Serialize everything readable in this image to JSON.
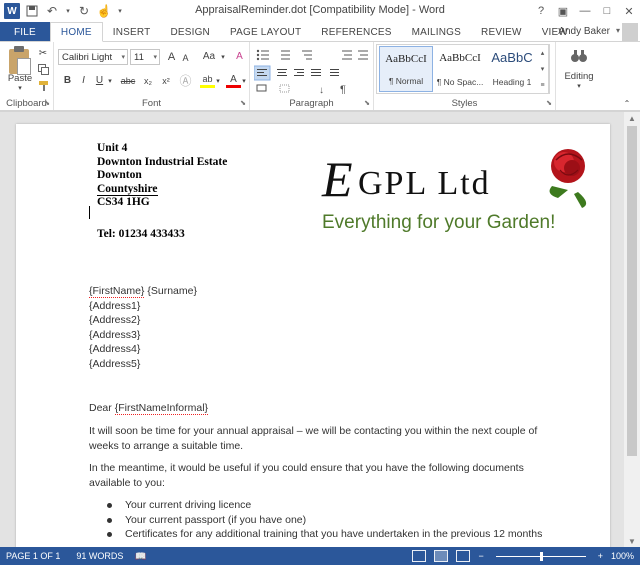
{
  "window": {
    "title": "AppraisalReminder.dot [Compatibility Mode] - Word",
    "app_icon_letter": "W"
  },
  "tabs": {
    "file": "FILE",
    "items": [
      "HOME",
      "INSERT",
      "DESIGN",
      "PAGE LAYOUT",
      "REFERENCES",
      "MAILINGS",
      "REVIEW",
      "VIEW"
    ],
    "active": "HOME"
  },
  "user": {
    "name": "Andy Baker"
  },
  "ribbon": {
    "clipboard": {
      "label": "Clipboard",
      "paste_label": "Paste"
    },
    "font": {
      "label": "Font",
      "font_name": "Calibri Light",
      "font_size": "11",
      "bold": "B",
      "italic": "I",
      "underline": "U",
      "strike": "abc",
      "subscript": "x₂",
      "superscript": "x²",
      "grow": "A",
      "shrink": "A",
      "case": "Aa",
      "clear": "A",
      "highlight": "ab",
      "color": "A"
    },
    "paragraph": {
      "label": "Paragraph"
    },
    "styles": {
      "label": "Styles",
      "items": [
        {
          "sample": "AaBbCcI",
          "name": "¶ Normal"
        },
        {
          "sample": "AaBbCcI",
          "name": "¶ No Spac..."
        },
        {
          "sample": "AaBbC",
          "name": "Heading 1"
        }
      ]
    },
    "editing": {
      "label": "Editing"
    }
  },
  "document": {
    "address_lines": [
      "Unit 4",
      "Downton Industrial Estate",
      "Downton",
      "Countyshire",
      "CS34 1HG"
    ],
    "tel": "Tel: 01234 433433",
    "logo": {
      "company": "EGPL Ltd",
      "tagline": "Everything for your Garden!"
    },
    "recipient": {
      "firstname": "{FirstName}",
      "surname": "{Surname}",
      "address1": "{Address1}",
      "address2": "{Address2}",
      "address3": "{Address3}",
      "address4": "{Address4}",
      "address5": "{Address5}"
    },
    "salutation_prefix": "Dear ",
    "salutation_field": "{FirstNameInformal}",
    "para1_line1": "It will soon be time for your annual appraisal – we will be contacting you within the next couple of",
    "para1_line2": "weeks to arrange a suitable time.",
    "para2_line1": "In the meantime, it would be useful if you could ensure that you have the following documents",
    "para2_line2": "available to you:",
    "bullets": [
      "Your current driving licence",
      "Your current passport (if you have one)",
      "Certificates for any additional training that you have undertaken in the previous 12 months"
    ]
  },
  "status": {
    "page": "PAGE 1 OF 1",
    "words": "91 WORDS",
    "zoom": "100%"
  },
  "colors": {
    "accent": "#2b579a",
    "logo_green": "#4f7a2a",
    "rose_red": "#c0161c"
  }
}
